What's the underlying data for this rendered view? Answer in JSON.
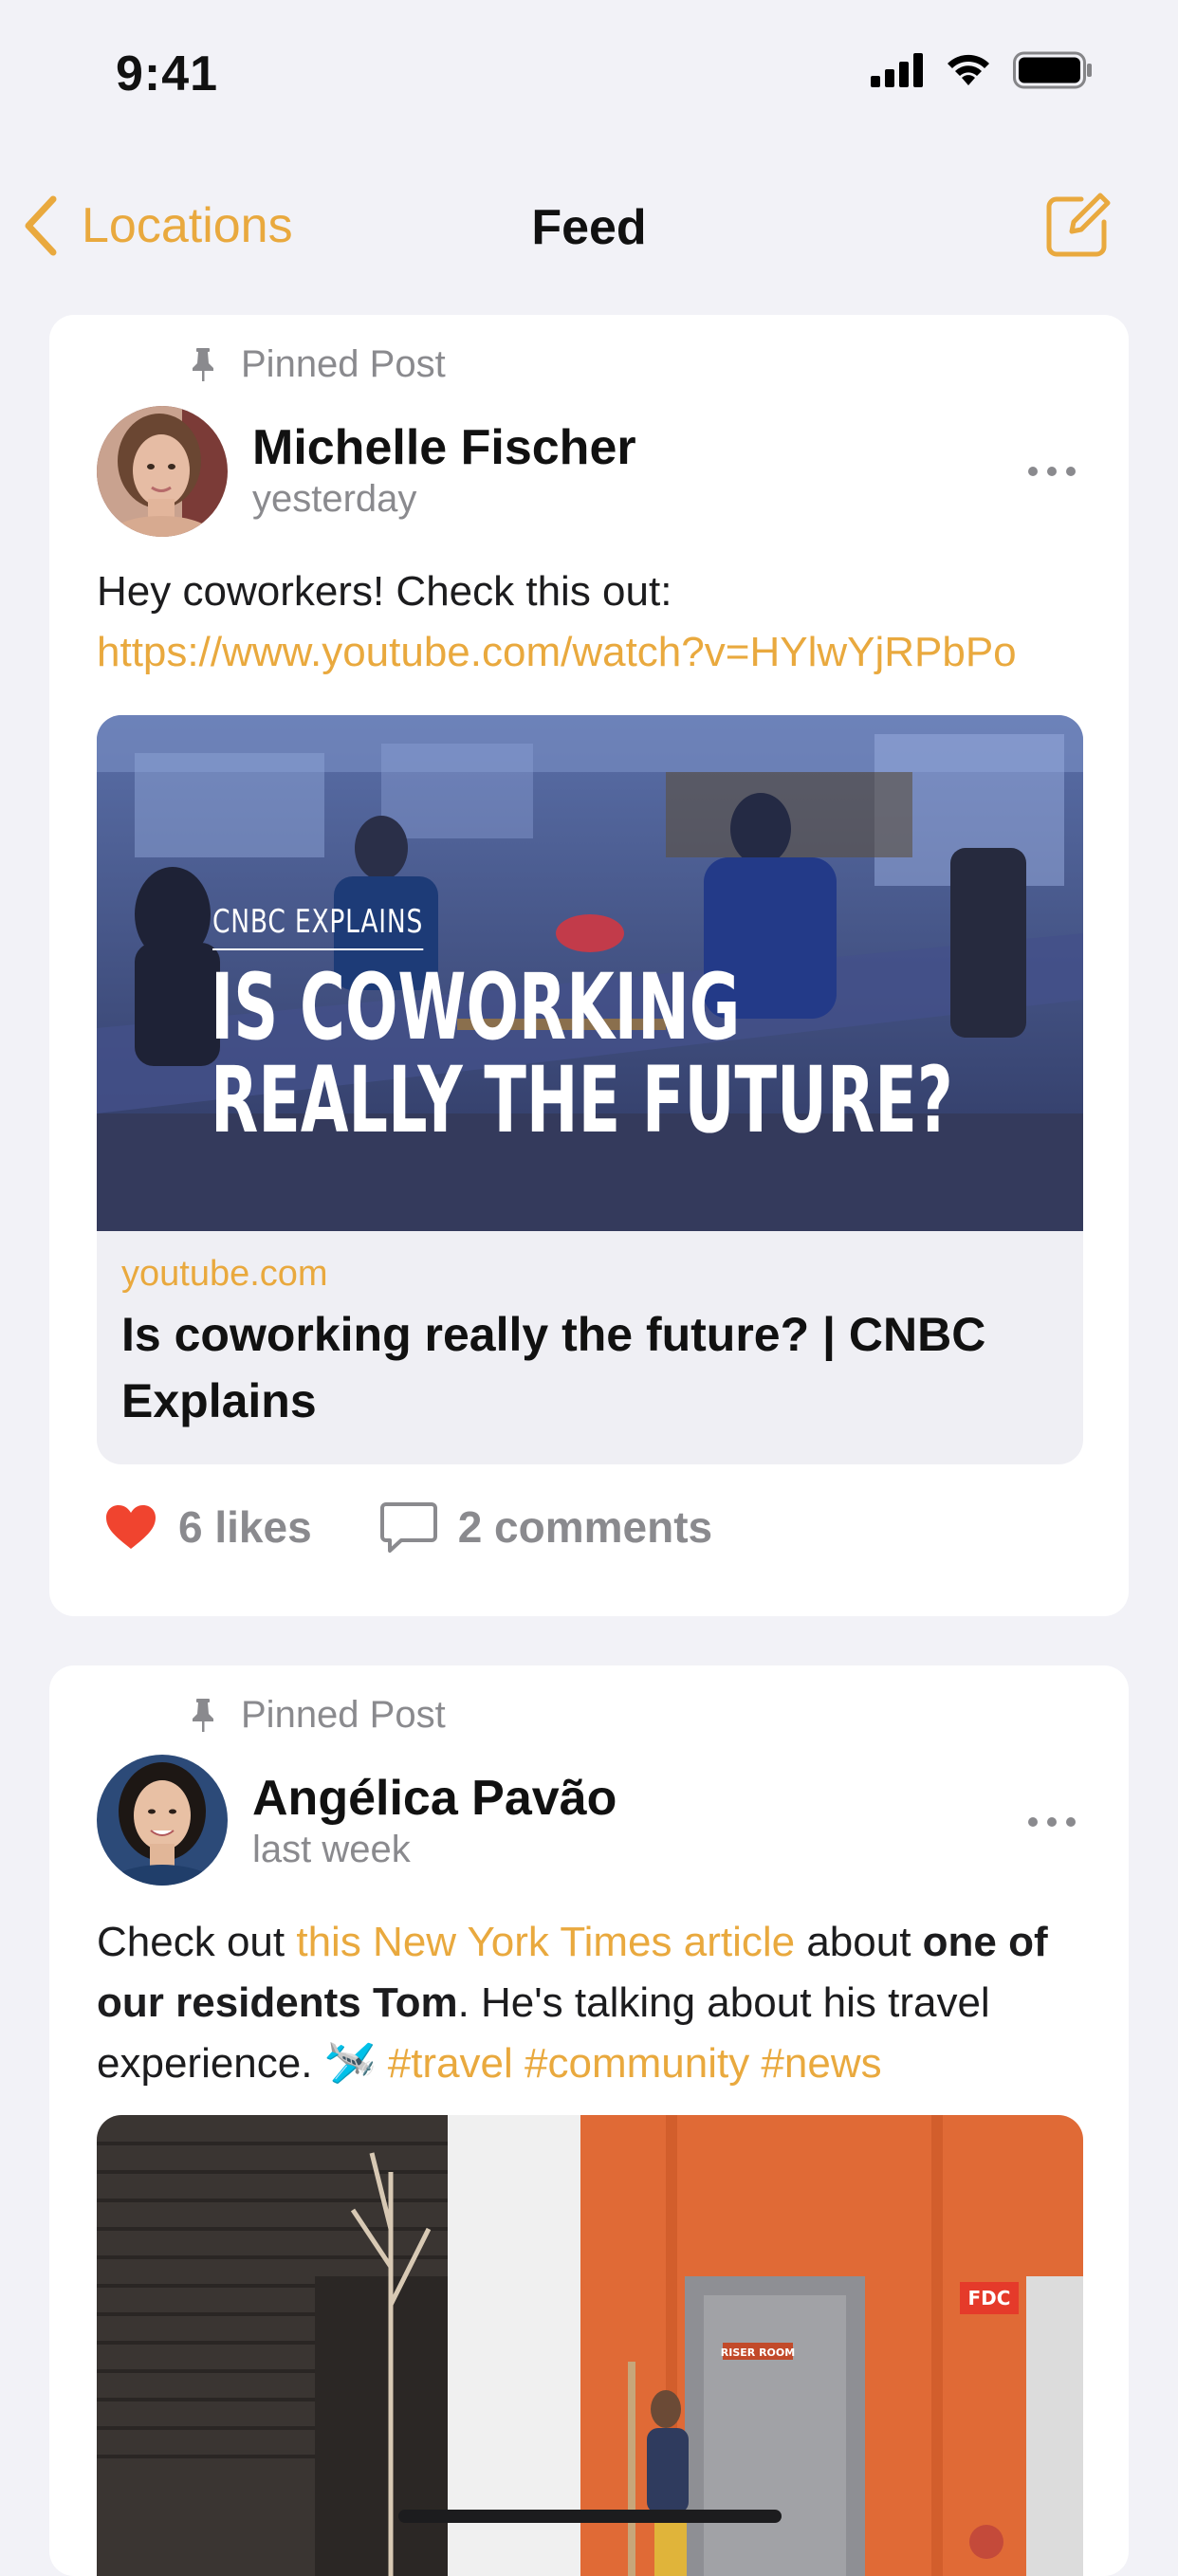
{
  "status": {
    "time": "9:41"
  },
  "nav": {
    "back_label": "Locations",
    "title": "Feed"
  },
  "posts": [
    {
      "pinned_label": "Pinned Post",
      "author": "Michelle Fischer",
      "timestamp": "yesterday",
      "text_plain": "Hey coworkers! Check this out: ",
      "text_link": "https://www.youtube.com/watch?v=HYlwYjRPbPo",
      "preview": {
        "overline": "CNBC EXPLAINS",
        "headline_line1": "IS COWORKING",
        "headline_line2": "REALLY THE FUTURE?",
        "domain": "youtube.com",
        "title": "Is coworking really the future? | CNBC Explains"
      },
      "likes": "6 likes",
      "comments": "2 comments"
    },
    {
      "pinned_label": "Pinned Post",
      "author": "Angélica Pavão",
      "timestamp": "last week",
      "text_1": "Check out ",
      "text_link": "this New York Times article",
      "text_2": " about ",
      "text_bold": "one of our residents Tom",
      "text_3": ". He's talking about his travel experience. ",
      "text_emoji": "🛩️",
      "text_tags": " #travel #community #news",
      "photo": {
        "sign_fdc": "FDC",
        "sign_riser": "RISER ROOM"
      }
    }
  ],
  "colors": {
    "accent": "#e9a93e",
    "like": "#f0442f",
    "background": "#f2f2f7",
    "secondary_text": "#8a8a8e"
  }
}
